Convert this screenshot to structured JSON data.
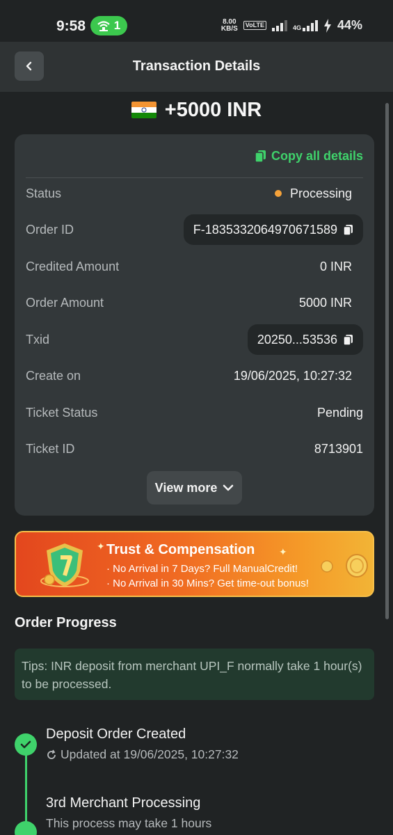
{
  "status_bar": {
    "time": "9:58",
    "wifi_count": "1",
    "speed_value": "8.00",
    "speed_unit": "KB/S",
    "volte": "VoLTE",
    "network": "4G",
    "battery": "44%"
  },
  "header": {
    "title": "Transaction Details",
    "back_icon": "chevron-left-icon"
  },
  "amount": {
    "value": "+5000 INR",
    "flag": "india-flag"
  },
  "details": {
    "copy_all_label": "Copy all details",
    "rows": [
      {
        "label": "Status",
        "value": "Processing"
      },
      {
        "label": "Order ID",
        "value": "F-1835332064970671589"
      },
      {
        "label": "Credited Amount",
        "value": "0 INR"
      },
      {
        "label": "Order Amount",
        "value": "5000 INR"
      },
      {
        "label": "Txid",
        "value": "20250...53536"
      },
      {
        "label": "Create on",
        "value": "19/06/2025, 10:27:32"
      },
      {
        "label": "Ticket Status",
        "value": "Pending"
      },
      {
        "label": "Ticket ID",
        "value": "8713901"
      }
    ],
    "view_more_label": "View more",
    "status_color": "#f5a23a",
    "accent_color": "#3fd26b"
  },
  "banner": {
    "title": "Trust & Compensation",
    "line1": "· No Arrival in 7 Days? Full ManualCredit!",
    "line2": "· No Arrival in 30 Mins? Get time-out bonus!"
  },
  "progress": {
    "title": "Order Progress",
    "tips": "Tips: INR deposit from merchant UPI_F normally take 1 hour(s) to be processed.",
    "steps": [
      {
        "title": "Deposit Order Created",
        "subtitle": "Updated at 19/06/2025, 10:27:32"
      },
      {
        "title": "3rd Merchant Processing",
        "subtitle": "This process may take 1 hours"
      }
    ]
  }
}
